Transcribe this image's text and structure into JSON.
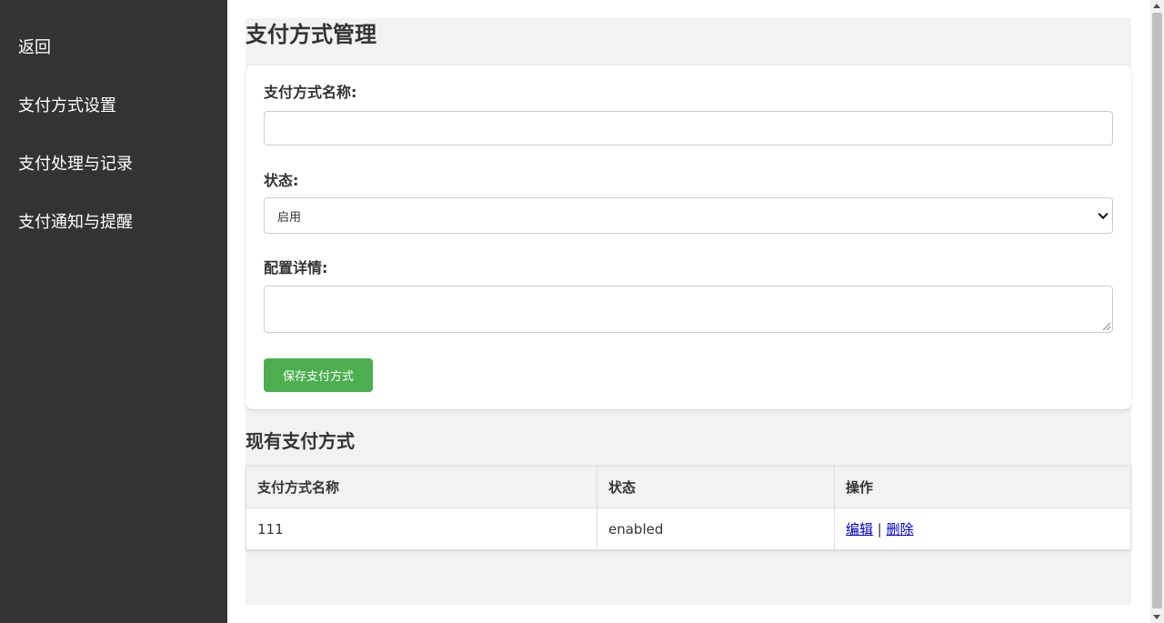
{
  "sidebar": {
    "items": [
      {
        "label": "返回"
      },
      {
        "label": "支付方式设置"
      },
      {
        "label": "支付处理与记录"
      },
      {
        "label": "支付通知与提醒"
      }
    ]
  },
  "page": {
    "title": "支付方式管理"
  },
  "form": {
    "name_label": "支付方式名称:",
    "name_value": "",
    "status_label": "状态:",
    "status_value": "启用",
    "config_label": "配置详情:",
    "config_value": "",
    "save_label": "保存支付方式"
  },
  "list": {
    "title": "现有支付方式",
    "headers": [
      "支付方式名称",
      "状态",
      "操作"
    ],
    "rows": [
      {
        "name": "111",
        "status": "enabled",
        "edit": "编辑",
        "sep": "|",
        "delete": "删除"
      }
    ]
  },
  "colors": {
    "sidebar_bg": "#333333",
    "save_button": "#4cae4f",
    "link": "#0000cc"
  }
}
